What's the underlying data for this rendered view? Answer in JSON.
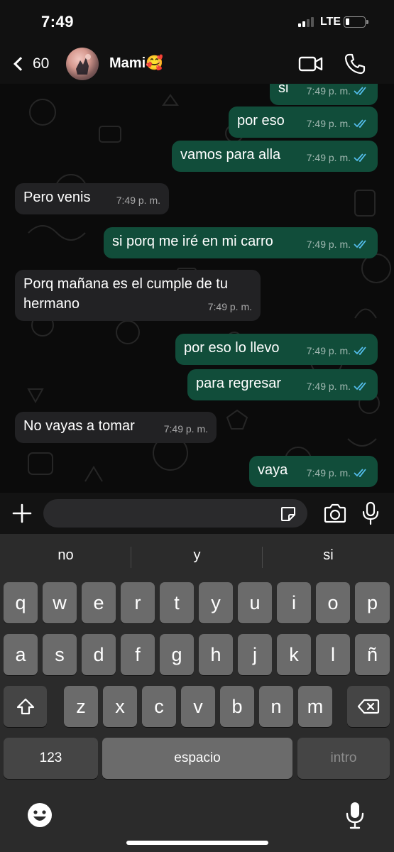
{
  "status_bar": {
    "time": "7:49",
    "network": "LTE"
  },
  "header": {
    "back_count": "60",
    "contact_name": "Mami🥰"
  },
  "messages": [
    {
      "text": "si",
      "time": "7:49 p. m.",
      "direction": "out",
      "read": true
    },
    {
      "text": "por eso",
      "time": "7:49 p. m.",
      "direction": "out",
      "read": true
    },
    {
      "text": "vamos para alla",
      "time": "7:49 p. m.",
      "direction": "out",
      "read": true
    },
    {
      "text": "Pero venis",
      "time": "7:49 p. m.",
      "direction": "in"
    },
    {
      "text": "si porq me iré en mi carro",
      "time": "7:49 p. m.",
      "direction": "out",
      "read": true
    },
    {
      "text": "Porq mañana es el cumple de tu hermano",
      "time": "7:49 p. m.",
      "direction": "in"
    },
    {
      "text": "por eso lo llevo",
      "time": "7:49 p. m.",
      "direction": "out",
      "read": true
    },
    {
      "text": "para regresar",
      "time": "7:49 p. m.",
      "direction": "out",
      "read": true
    },
    {
      "text": "No vayas a tomar",
      "time": "7:49 p. m.",
      "direction": "in"
    },
    {
      "text": "vaya",
      "time": "7:49 p. m.",
      "direction": "out",
      "read": true
    }
  ],
  "input": {
    "value": "",
    "placeholder": ""
  },
  "keyboard": {
    "suggestions": [
      "no",
      "y",
      "si"
    ],
    "row1": [
      "q",
      "w",
      "e",
      "r",
      "t",
      "y",
      "u",
      "i",
      "o",
      "p"
    ],
    "row2": [
      "a",
      "s",
      "d",
      "f",
      "g",
      "h",
      "j",
      "k",
      "l",
      "ñ"
    ],
    "row3": [
      "z",
      "x",
      "c",
      "v",
      "b",
      "n",
      "m"
    ],
    "numbers_label": "123",
    "space_label": "espacio",
    "return_label": "intro"
  },
  "icons": {
    "back": "chevron-left-icon",
    "video": "video-camera-icon",
    "call": "phone-icon",
    "plus": "plus-icon",
    "sticker": "sticker-icon",
    "camera": "camera-icon",
    "mic": "microphone-icon",
    "shift": "shift-icon",
    "delete": "backspace-icon",
    "emoji": "emoji-icon",
    "dictation": "dictation-mic-icon"
  },
  "colors": {
    "outgoing_bubble": "#114d3a",
    "incoming_bubble": "#222224",
    "read_ticks": "#53bdeb"
  }
}
